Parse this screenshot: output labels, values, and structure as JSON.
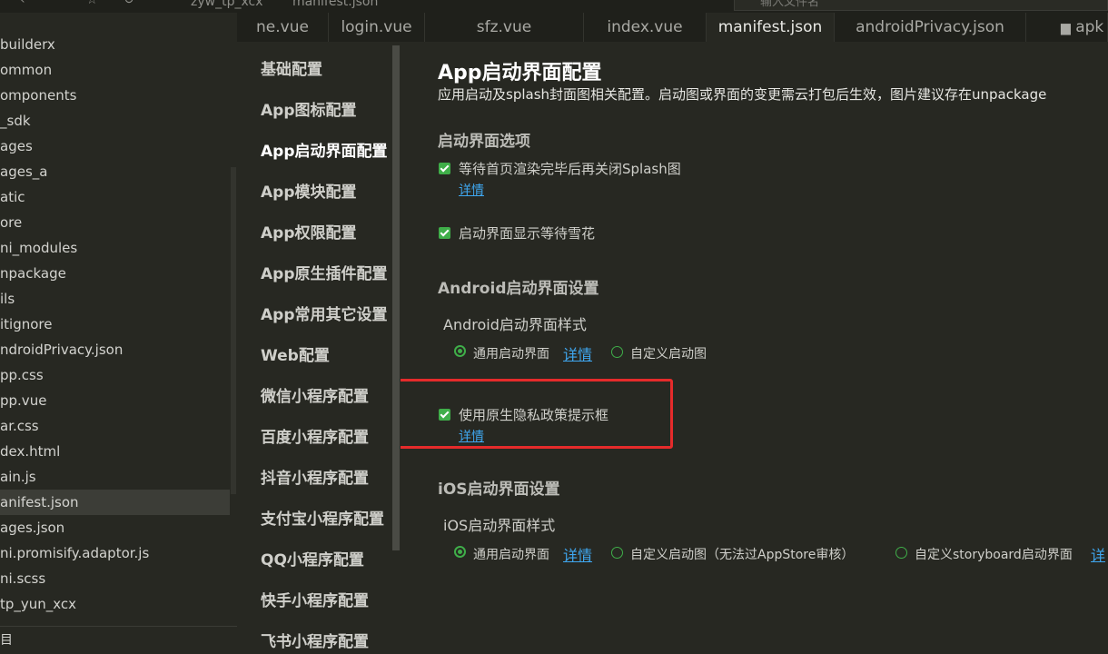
{
  "topbar": {
    "crumbs": [
      "zyw_tp_xcx",
      "manifest.json"
    ],
    "search_placeholder": "输入文件名",
    "back_icon": "chevron-left-icon",
    "star_icon": "star-icon",
    "refresh_icon": "refresh-icon"
  },
  "file_tree": {
    "items": [
      {
        "label": "builderx",
        "active": false
      },
      {
        "label": "ommon",
        "active": false
      },
      {
        "label": "omponents",
        "active": false
      },
      {
        "label": "_sdk",
        "active": false
      },
      {
        "label": "ages",
        "active": false
      },
      {
        "label": "ages_a",
        "active": false
      },
      {
        "label": "atic",
        "active": false
      },
      {
        "label": "ore",
        "active": false
      },
      {
        "label": "ni_modules",
        "active": false
      },
      {
        "label": "npackage",
        "active": false
      },
      {
        "label": "ils",
        "active": false
      },
      {
        "label": "itignore",
        "active": false
      },
      {
        "label": "ndroidPrivacy.json",
        "active": false
      },
      {
        "label": "pp.css",
        "active": false
      },
      {
        "label": "pp.vue",
        "active": false
      },
      {
        "label": "ar.css",
        "active": false
      },
      {
        "label": "dex.html",
        "active": false
      },
      {
        "label": "ain.js",
        "active": false
      },
      {
        "label": "anifest.json",
        "active": true
      },
      {
        "label": "ages.json",
        "active": false
      },
      {
        "label": "ni.promisify.adaptor.js",
        "active": false
      },
      {
        "label": "ni.scss",
        "active": false
      },
      {
        "label": "tp_yun_xcx",
        "active": false
      }
    ],
    "footer_label": "目"
  },
  "tabs": [
    {
      "label": "ne.vue",
      "active": false
    },
    {
      "label": "login.vue",
      "active": false
    },
    {
      "label": "sfz.vue",
      "active": false
    },
    {
      "label": "index.vue",
      "active": false
    },
    {
      "label": "manifest.json",
      "active": true
    },
    {
      "label": "androidPrivacy.json",
      "active": false
    },
    {
      "label": "apk",
      "active": false,
      "icon": "folder-icon"
    }
  ],
  "settings_nav": [
    {
      "label": "基础配置",
      "active": false
    },
    {
      "label": "App图标配置",
      "active": false
    },
    {
      "label": "App启动界面配置",
      "active": true
    },
    {
      "label": "App模块配置",
      "active": false
    },
    {
      "label": "App权限配置",
      "active": false
    },
    {
      "label": "App原生插件配置",
      "active": false
    },
    {
      "label": "App常用其它设置",
      "active": false
    },
    {
      "label": "Web配置",
      "active": false
    },
    {
      "label": "微信小程序配置",
      "active": false
    },
    {
      "label": "百度小程序配置",
      "active": false
    },
    {
      "label": "抖音小程序配置",
      "active": false
    },
    {
      "label": "支付宝小程序配置",
      "active": false
    },
    {
      "label": "QQ小程序配置",
      "active": false
    },
    {
      "label": "快手小程序配置",
      "active": false
    },
    {
      "label": "飞书小程序配置",
      "active": false
    }
  ],
  "content": {
    "title": "App启动界面配置",
    "description": "应用启动及splash封面图相关配置。启动图或界面的变更需云打包后生效，图片建议存在unpackage",
    "splash_options": {
      "heading": "启动界面选项",
      "wait_render": {
        "label": "等待首页渲染完毕后再关闭Splash图",
        "checked": true,
        "link": "详情"
      },
      "show_snow": {
        "label": "启动界面显示等待雪花",
        "checked": true
      }
    },
    "android": {
      "heading": "Android启动界面设置",
      "style_label": "Android启动界面样式",
      "option_common": "通用启动界面",
      "option_common_link": "详情",
      "option_custom": "自定义启动图",
      "selected": "通用启动界面",
      "privacy": {
        "label": "使用原生隐私政策提示框",
        "checked": true,
        "link": "详情"
      }
    },
    "ios": {
      "heading": "iOS启动界面设置",
      "style_label": "iOS启动界面样式",
      "option_common": "通用启动界面",
      "option_common_link": "详情",
      "option_custom": "自定义启动图（无法过AppStore审核）",
      "option_storyboard": "自定义storyboard启动界面",
      "option_storyboard_link": "详",
      "selected": "通用启动界面"
    }
  },
  "colors": {
    "background": "#272822",
    "accent_green": "#3fae49",
    "link_blue": "#3fa7f0",
    "highlight_red": "#e52b2b"
  }
}
